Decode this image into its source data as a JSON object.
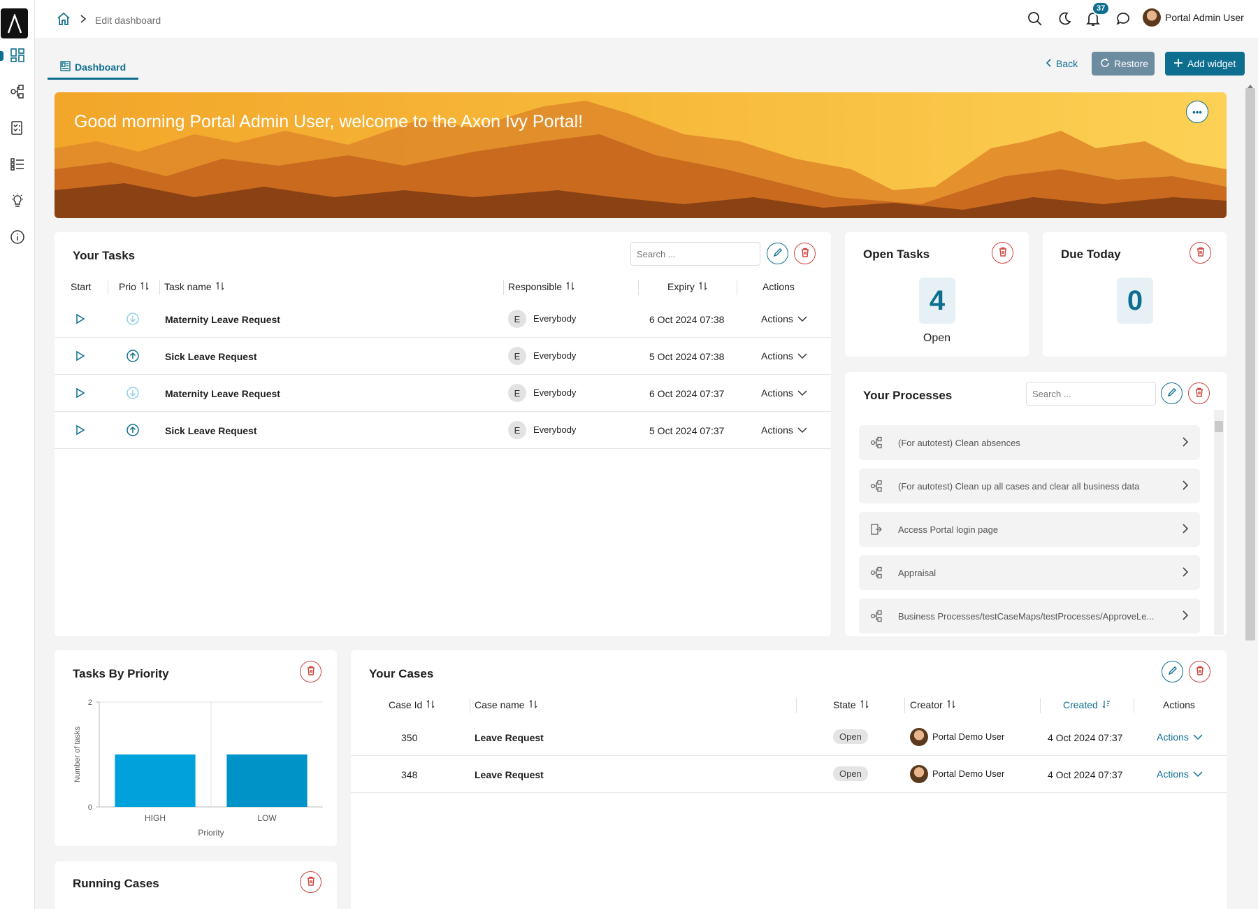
{
  "breadcrumb": {
    "current": "Edit dashboard"
  },
  "topbar": {
    "notification_count": "37",
    "user_name": "Portal Admin User"
  },
  "tabs": {
    "dashboard": "Dashboard"
  },
  "actions": {
    "back": "Back",
    "restore": "Restore",
    "add_widget": "Add widget"
  },
  "banner": {
    "greeting": "Good morning Portal Admin User, welcome to the Axon Ivy Portal!",
    "more": "•••"
  },
  "your_tasks": {
    "title": "Your Tasks",
    "search_placeholder": "Search ...",
    "columns": {
      "start": "Start",
      "prio": "Prio",
      "task_name": "Task name",
      "responsible": "Responsible",
      "expiry": "Expiry",
      "actions": "Actions"
    },
    "rows": [
      {
        "name": "Maternity Leave Request",
        "responsible_initial": "E",
        "responsible": "Everybody",
        "expiry": "6 Oct 2024 07:38",
        "actions": "Actions",
        "priority": "low"
      },
      {
        "name": "Sick Leave Request",
        "responsible_initial": "E",
        "responsible": "Everybody",
        "expiry": "5 Oct 2024 07:38",
        "actions": "Actions",
        "priority": "high"
      },
      {
        "name": "Maternity Leave Request",
        "responsible_initial": "E",
        "responsible": "Everybody",
        "expiry": "6 Oct 2024 07:37",
        "actions": "Actions",
        "priority": "low"
      },
      {
        "name": "Sick Leave Request",
        "responsible_initial": "E",
        "responsible": "Everybody",
        "expiry": "5 Oct 2024 07:37",
        "actions": "Actions",
        "priority": "high"
      }
    ]
  },
  "open_tasks": {
    "title": "Open Tasks",
    "value": "4",
    "label": "Open"
  },
  "due_today": {
    "title": "Due Today",
    "value": "0"
  },
  "your_processes": {
    "title": "Your Processes",
    "search_placeholder": "Search ...",
    "items": [
      {
        "label": "(For autotest) Clean absences",
        "icon": "process-icon"
      },
      {
        "label": "(For autotest) Clean up all cases and clear all business data",
        "icon": "process-icon"
      },
      {
        "label": "Access Portal login page",
        "icon": "external-link-icon"
      },
      {
        "label": "Appraisal",
        "icon": "process-icon"
      },
      {
        "label": "Business Processes/testCaseMaps/testProcesses/ApproveLe...",
        "icon": "process-icon"
      }
    ]
  },
  "tasks_by_priority": {
    "title": "Tasks By Priority"
  },
  "chart_data": {
    "type": "bar",
    "categories": [
      "HIGH",
      "LOW"
    ],
    "values": [
      1,
      1
    ],
    "xlabel": "Priority",
    "ylabel": "Number of tasks",
    "ylim": [
      0,
      2
    ],
    "yticks": [
      "0",
      "2"
    ],
    "colors": [
      "#00a2dc",
      "#0093c8"
    ],
    "grid": true
  },
  "your_cases": {
    "title": "Your Cases",
    "columns": {
      "case_id": "Case Id",
      "case_name": "Case name",
      "state": "State",
      "creator": "Creator",
      "created": "Created",
      "actions": "Actions"
    },
    "rows": [
      {
        "id": "350",
        "name": "Leave Request",
        "state": "Open",
        "creator": "Portal Demo User",
        "created": "4 Oct 2024 07:37",
        "actions": "Actions"
      },
      {
        "id": "348",
        "name": "Leave Request",
        "state": "Open",
        "creator": "Portal Demo User",
        "created": "4 Oct 2024 07:37",
        "actions": "Actions"
      }
    ]
  },
  "running_cases": {
    "title": "Running Cases"
  },
  "colors": {
    "primary": "#0d6e8f",
    "danger": "#d0423b",
    "restore_bg": "#6c8da0"
  }
}
